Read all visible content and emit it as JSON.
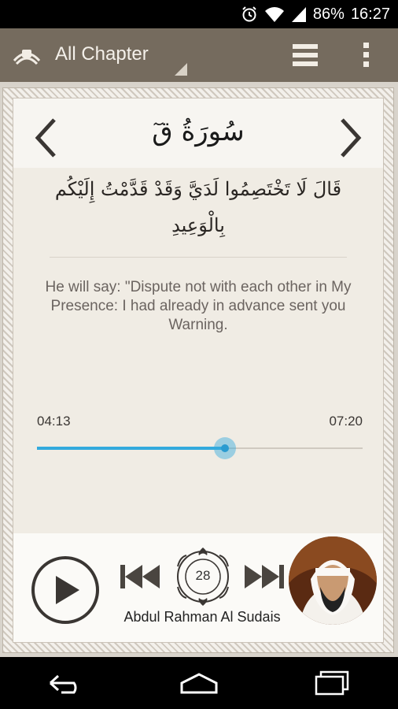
{
  "status_bar": {
    "battery": "86%",
    "time": "16:27"
  },
  "action_bar": {
    "title": "All Chapter"
  },
  "surah": {
    "name": "سُورَةُ قٓ"
  },
  "ayah": {
    "arabic": "قَالَ لَا تَخْتَصِمُوا لَدَيَّ وَقَدْ قَدَّمْتُ إِلَيْكُم بِالْوَعِيدِ",
    "translation": "He will say: \"Dispute not with each other in My Presence: I had already in advance sent you Warning."
  },
  "player": {
    "elapsed": "04:13",
    "total": "07:20",
    "progress": 0.578,
    "ayah_number": "28",
    "reciter": "Abdul Rahman Al Sudais"
  },
  "colors": {
    "accent": "#33aadd",
    "action_bar": "#756b5e"
  }
}
